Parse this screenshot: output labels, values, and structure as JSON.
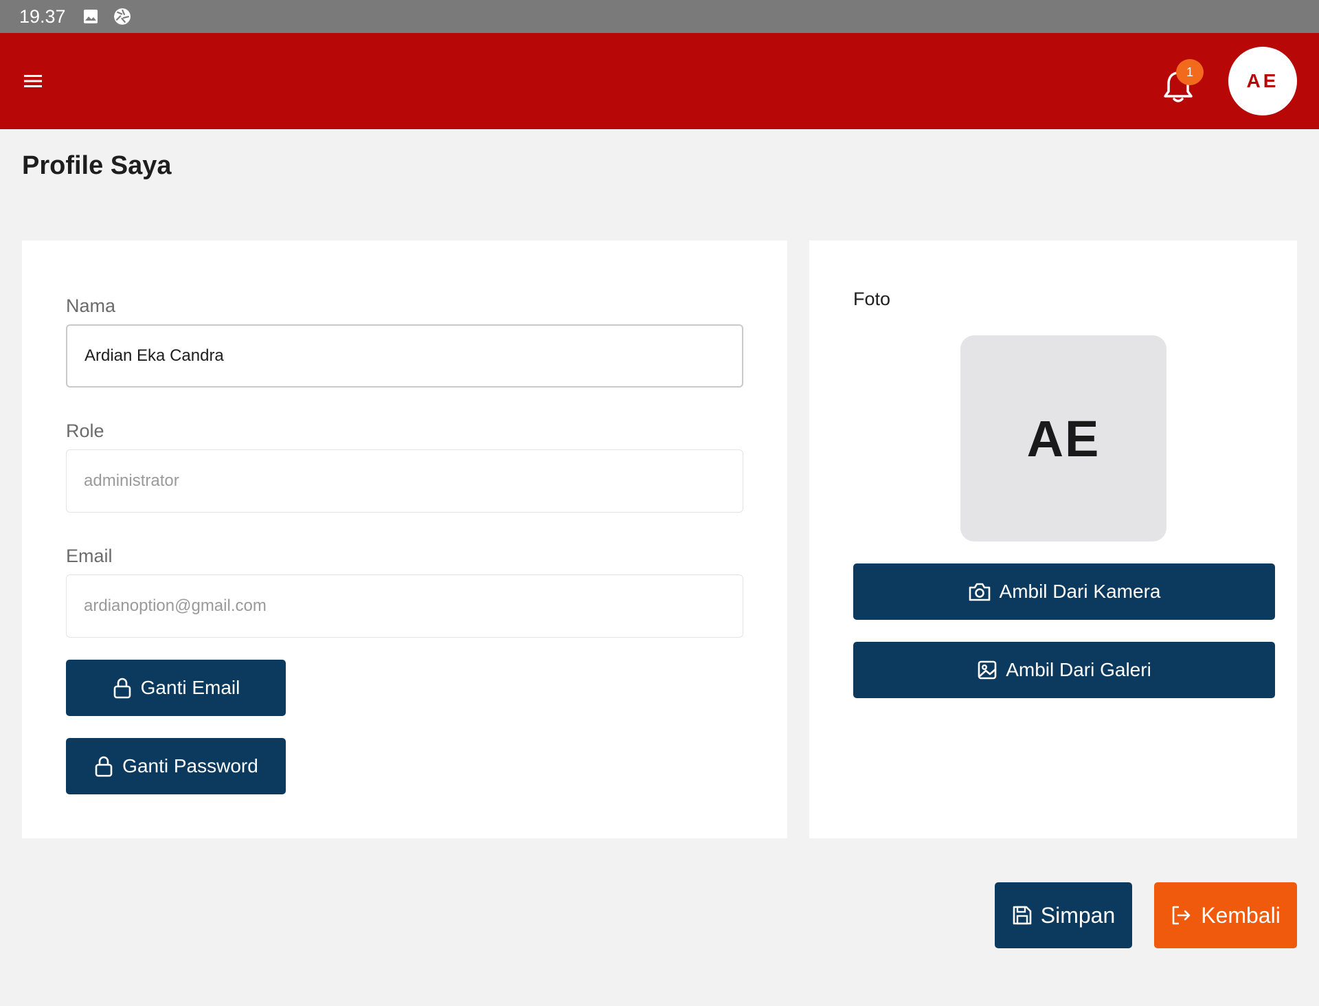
{
  "status_bar": {
    "time": "19.37",
    "icons": [
      "image-icon",
      "shutter-icon"
    ]
  },
  "app_bar": {
    "menu_icon": "menu-icon",
    "notification_icon": "bell-icon",
    "notification_count": "1",
    "avatar_initials": "AE",
    "color": "#b70707"
  },
  "page": {
    "title": "Profile Saya"
  },
  "form": {
    "nama": {
      "label": "Nama",
      "value": "Ardian Eka Candra"
    },
    "role": {
      "label": "Role",
      "value": "administrator"
    },
    "email": {
      "label": "Email",
      "value": "ardianoption@gmail.com"
    },
    "ganti_email": {
      "label": "Ganti Email",
      "icon": "lock-icon"
    },
    "ganti_password": {
      "label": "Ganti Password",
      "icon": "lock-icon"
    }
  },
  "photo": {
    "label": "Foto",
    "initials": "AE",
    "camera_button": {
      "label": "Ambil Dari Kamera",
      "icon": "camera-icon"
    },
    "gallery_button": {
      "label": "Ambil Dari Galeri",
      "icon": "gallery-icon"
    }
  },
  "actions": {
    "save": {
      "label": "Simpan",
      "icon": "save-icon"
    },
    "back": {
      "label": "Kembali",
      "icon": "exit-icon"
    }
  },
  "colors": {
    "primary": "#0c3a5e",
    "accent": "#ef5a0c",
    "header": "#b70707",
    "badge": "#f26b1d"
  }
}
